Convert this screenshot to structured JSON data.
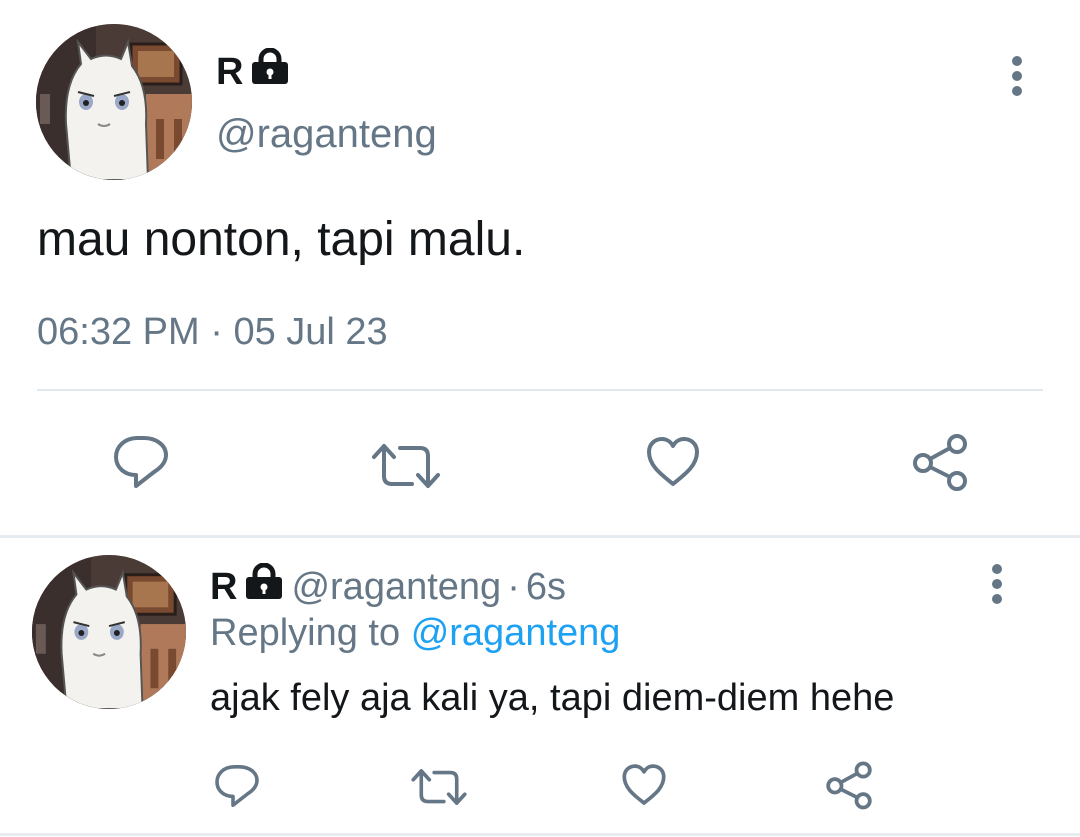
{
  "main_tweet": {
    "display_name": "R",
    "handle": "@raganteng",
    "text": "mau nonton, tapi malu.",
    "time": "06:32 PM",
    "separator": "·",
    "date": "05 Jul 23",
    "avatar_icon": "moomin-avatar",
    "lock_icon": "lock-icon",
    "more_icon": "more-vertical-icon",
    "actions": [
      "reply-icon",
      "retweet-icon",
      "like-icon",
      "share-icon"
    ]
  },
  "reply_tweet": {
    "display_name": "R",
    "handle": "@raganteng",
    "separator": "·",
    "age": "6s",
    "replying_label": "Replying to",
    "replying_handle": "@raganteng",
    "text": "ajak fely aja kali ya, tapi diem-diem hehe",
    "avatar_icon": "moomin-avatar",
    "lock_icon": "lock-icon",
    "more_icon": "more-vertical-icon",
    "actions": [
      "reply-icon",
      "retweet-icon",
      "like-icon",
      "share-icon"
    ]
  },
  "colors": {
    "text": "#14171a",
    "secondary": "#657786",
    "link": "#1da1f2",
    "icon": "#657786",
    "divider": "#e1e8ed"
  }
}
